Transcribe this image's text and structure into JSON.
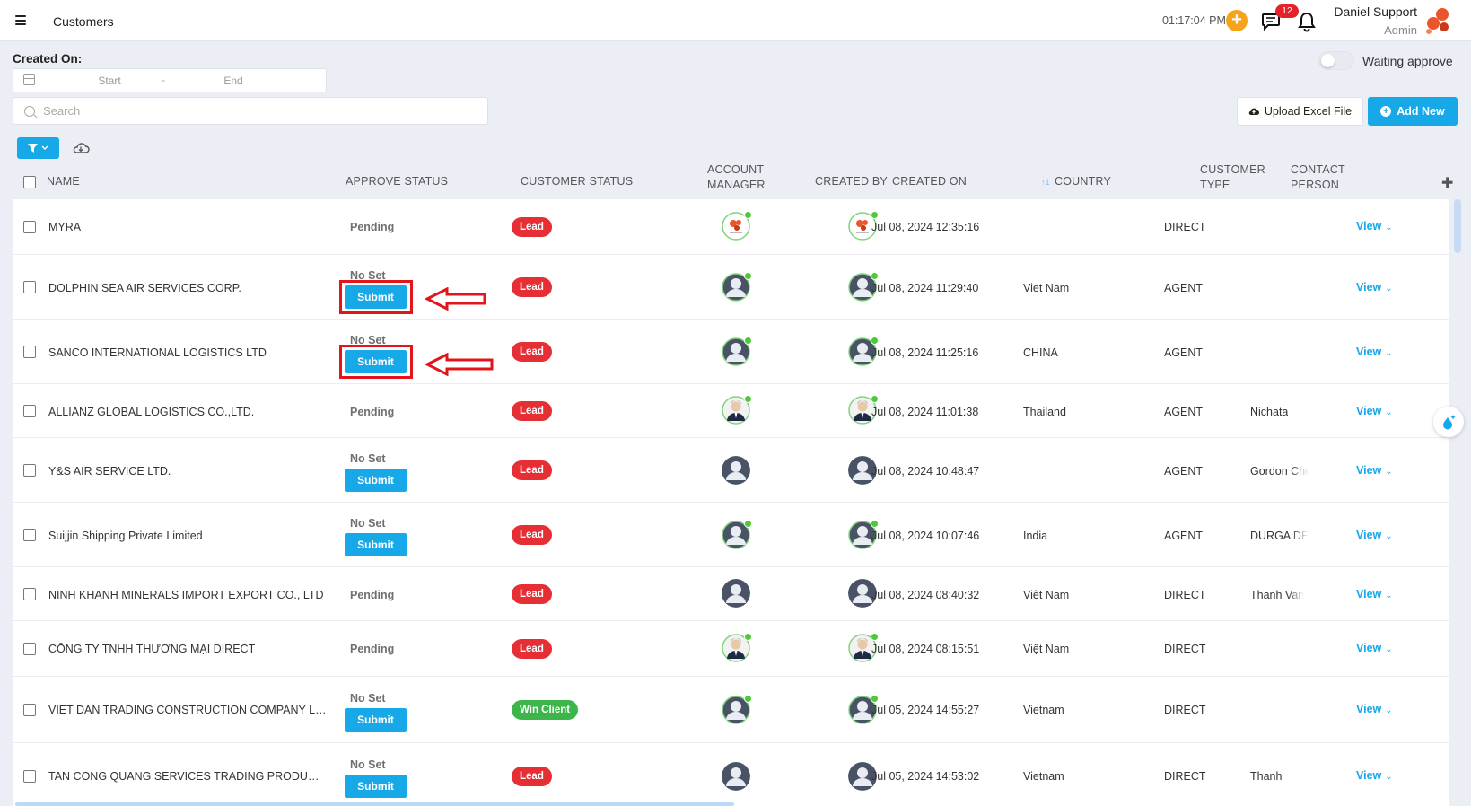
{
  "header": {
    "title": "Customers",
    "time": "01:17:04 PM",
    "plus_label": "+",
    "chat_badge": "12",
    "user_name": "Daniel Support",
    "user_role": "Admin"
  },
  "filters": {
    "created_on_label": "Created On:",
    "start_placeholder": "Start",
    "separator": "-",
    "end_placeholder": "End",
    "search_placeholder": "Search",
    "waiting_approve_label": "Waiting approve",
    "upload_label": "Upload Excel File",
    "add_new_label": "Add New"
  },
  "table": {
    "columns": {
      "name": "NAME",
      "approve_status": "APPROVE STATUS",
      "customer_status": "CUSTOMER STATUS",
      "account_manager_1": "ACCOUNT",
      "account_manager_2": "MANAGER",
      "created_by": "CREATED BY",
      "created_on": "CREATED ON",
      "sort_indicator": "↑1",
      "country": "COUNTRY",
      "customer_type_1": "CUSTOMER",
      "customer_type_2": "TYPE",
      "contact_person_1": "CONTACT",
      "contact_person_2": "PERSON",
      "add_col": "✚"
    },
    "rows": [
      {
        "name": "MYRA",
        "approve": "Pending",
        "submit": "",
        "status": "Lead",
        "created_on": "Jul 08, 2024 12:35:16",
        "country": "",
        "type": "DIRECT",
        "contact": "",
        "view": "View",
        "avatar": "logo"
      },
      {
        "name": "DOLPHIN SEA AIR SERVICES CORP.",
        "approve": "No Set",
        "submit": "Submit",
        "status": "Lead",
        "created_on": "Jul 08, 2024 11:29:40",
        "country": "Viet Nam",
        "type": "AGENT",
        "contact": "",
        "view": "View",
        "avatar": "generic-green"
      },
      {
        "name": "SANCO INTERNATIONAL LOGISTICS LTD",
        "approve": "No Set",
        "submit": "Submit",
        "status": "Lead",
        "created_on": "Jul 08, 2024 11:25:16",
        "country": "CHINA",
        "type": "AGENT",
        "contact": "",
        "view": "View",
        "avatar": "generic-green"
      },
      {
        "name": "ALLIANZ GLOBAL LOGISTICS CO.,LTD.",
        "approve": "Pending",
        "submit": "",
        "status": "Lead",
        "created_on": "Jul 08, 2024 11:01:38",
        "country": "Thailand",
        "type": "AGENT",
        "contact": "Nichata",
        "view": "View",
        "avatar": "photo"
      },
      {
        "name": "Y&S AIR SERVICE LTD.",
        "approve": "No Set",
        "submit": "Submit",
        "status": "Lead",
        "created_on": "Jul 08, 2024 10:48:47",
        "country": "",
        "type": "AGENT",
        "contact": "Gordon Che",
        "view": "View",
        "avatar": "generic"
      },
      {
        "name": "Suijjin Shipping Private Limited",
        "approve": "No Set",
        "submit": "Submit",
        "status": "Lead",
        "created_on": "Jul 08, 2024 10:07:46",
        "country": "India",
        "type": "AGENT",
        "contact": "DURGA DE",
        "view": "View",
        "avatar": "generic-green"
      },
      {
        "name": "NINH KHANH MINERALS IMPORT EXPORT CO., LTD",
        "approve": "Pending",
        "submit": "",
        "status": "Lead",
        "created_on": "Jul 08, 2024 08:40:32",
        "country": "Việt Nam",
        "type": "DIRECT",
        "contact": "Thanh Van",
        "view": "View",
        "avatar": "generic"
      },
      {
        "name": "CÔNG TY TNHH THƯƠNG MẠI DIRECT",
        "approve": "Pending",
        "submit": "",
        "status": "Lead",
        "created_on": "Jul 08, 2024 08:15:51",
        "country": "Việt Nam",
        "type": "DIRECT",
        "contact": "",
        "view": "View",
        "avatar": "photo"
      },
      {
        "name": "VIET DAN TRADING CONSTRUCTION COMPANY LIMITED",
        "approve": "No Set",
        "submit": "Submit",
        "status": "Win Client",
        "created_on": "Jul 05, 2024 14:55:27",
        "country": "Vietnam",
        "type": "DIRECT",
        "contact": "",
        "view": "View",
        "avatar": "generic-green"
      },
      {
        "name": "TAN CONG QUANG SERVICES TRADING PRODUCTION CO...",
        "approve": "No Set",
        "submit": "Submit",
        "status": "Lead",
        "created_on": "Jul 05, 2024 14:53:02",
        "country": "Vietnam",
        "type": "DIRECT",
        "contact": "Thanh",
        "view": "View",
        "avatar": "generic"
      }
    ]
  },
  "colors": {
    "accent": "#17a8e8",
    "lead": "#e52f35",
    "win": "#3cb54a",
    "annotation": "#e3141b"
  }
}
